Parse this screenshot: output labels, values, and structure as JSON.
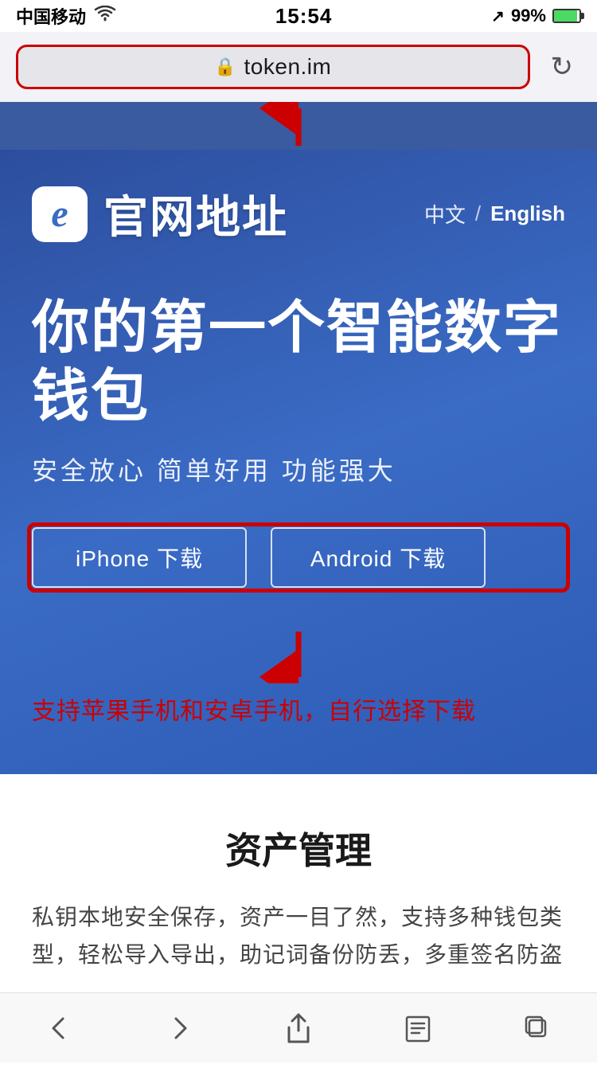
{
  "statusBar": {
    "carrier": "中国移动",
    "wifi": "WiFi",
    "time": "15:54",
    "location": "↗",
    "battery": "99%"
  },
  "browserBar": {
    "url": "token.im",
    "refreshIcon": "↻"
  },
  "website": {
    "logo": "e",
    "title": "官网地址",
    "lang": {
      "zh": "中文",
      "divider": "/",
      "en": "English"
    },
    "hero": {
      "title": "你的第一个智能数字钱包",
      "subtitle": "安全放心  简单好用  功能强大"
    },
    "buttons": {
      "iphone": "iPhone 下载",
      "android": "Android 下载"
    },
    "supportText": "支持苹果手机和安卓手机，自行选择下载",
    "section": {
      "title": "资产管理",
      "desc": "私钥本地安全保存，资产一目了然，支持多种钱包类型，轻松导入导出，助记词备份防丢，多重签名防盗"
    }
  },
  "bottomNav": {
    "back": "‹",
    "forward": "›",
    "share": "↑",
    "bookmarks": "□",
    "tabs": "⧉"
  }
}
